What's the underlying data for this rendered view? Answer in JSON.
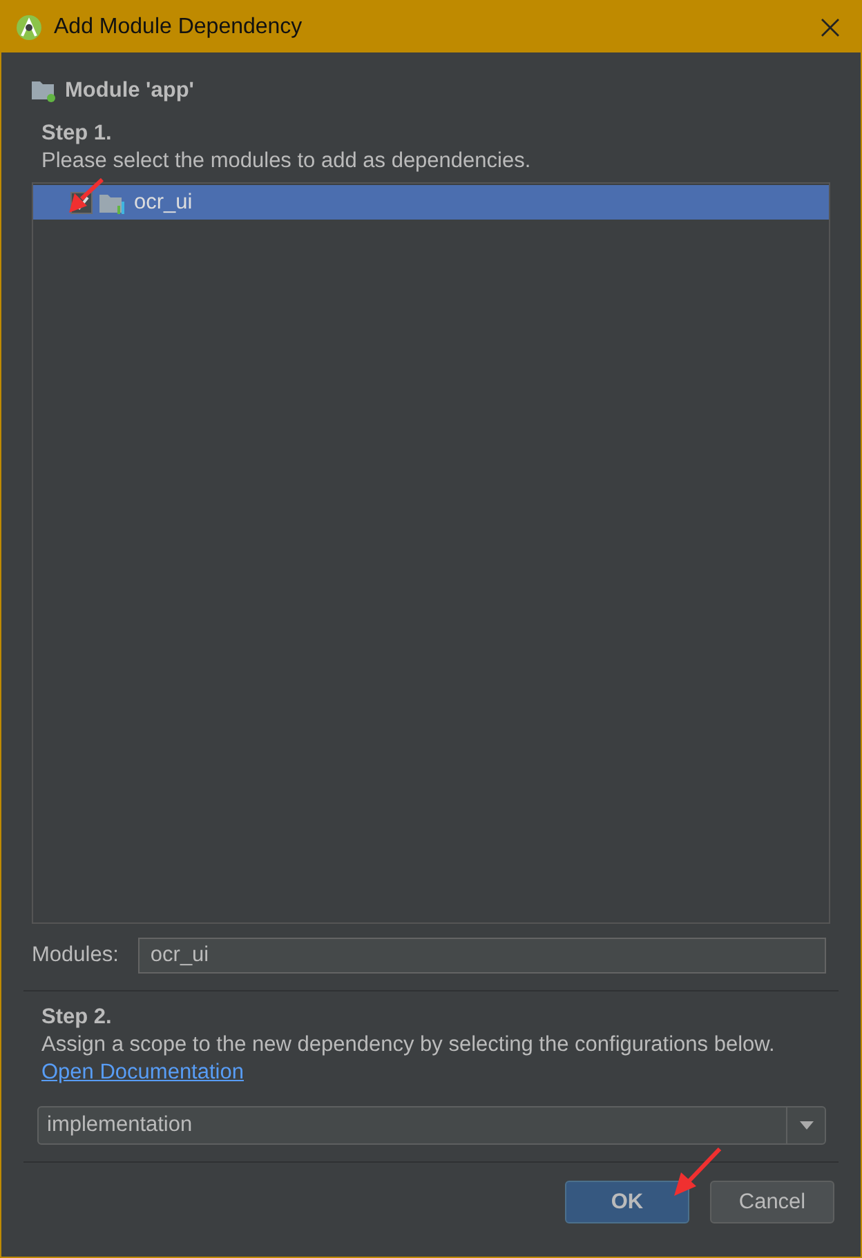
{
  "window": {
    "title": "Add Module Dependency"
  },
  "module_label": "Module 'app'",
  "step1": {
    "heading": "Step 1.",
    "instruction": "Please select the modules to add as dependencies."
  },
  "modules": [
    {
      "name": "ocr_ui",
      "checked": true,
      "selected": true
    }
  ],
  "modules_field": {
    "label": "Modules:",
    "value": "ocr_ui"
  },
  "step2": {
    "heading": "Step 2.",
    "instruction": "Assign a scope to the new dependency by selecting the configurations below.",
    "link": "Open Documentation"
  },
  "scope": {
    "value": "implementation"
  },
  "buttons": [
    {
      "label": "OK",
      "kind": "primary"
    },
    {
      "label": "Cancel",
      "kind": "secondary"
    }
  ]
}
